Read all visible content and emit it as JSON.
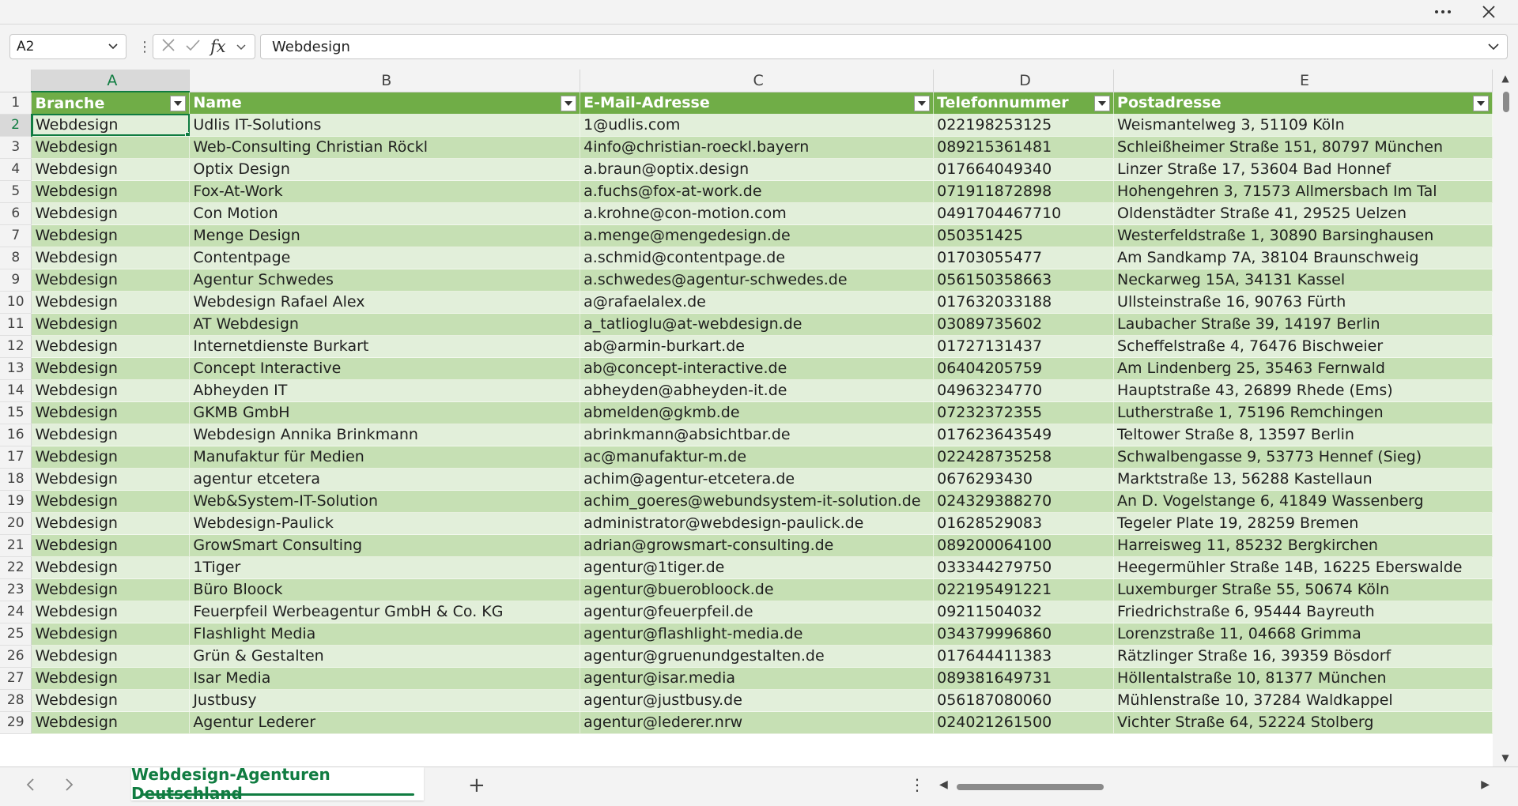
{
  "titlebar": {
    "more_icon": "more-horizontal-icon",
    "close_icon": "close-icon"
  },
  "formula_bar": {
    "name_box": "A2",
    "formula_value": "Webdesign",
    "cancel_icon": "cancel-x-icon",
    "enter_icon": "checkmark-icon",
    "fx_label": "fx"
  },
  "columns": [
    "A",
    "B",
    "C",
    "D",
    "E"
  ],
  "table": {
    "headers": [
      "Branche",
      "Name",
      "E-Mail-Adresse",
      "Telefonnummer",
      "Postadresse"
    ],
    "rows": [
      [
        "Webdesign",
        "Udlis IT-Solutions",
        "1@udlis.com",
        "022198253125",
        "Weismantelweg 3, 51109 Köln"
      ],
      [
        "Webdesign",
        "Web-Consulting Christian Röckl",
        "4info@christian-roeckl.bayern",
        "089215361481",
        "Schleißheimer Straße 151, 80797 München"
      ],
      [
        "Webdesign",
        "Optix Design",
        "a.braun@optix.design",
        "017664049340",
        "Linzer Straße 17, 53604 Bad Honnef"
      ],
      [
        "Webdesign",
        "Fox-At-Work",
        "a.fuchs@fox-at-work.de",
        "071911872898",
        "Hohengehren 3, 71573 Allmersbach Im Tal"
      ],
      [
        "Webdesign",
        "Con Motion",
        "a.krohne@con-motion.com",
        "0491704467710",
        "Oldenstädter Straße 41, 29525 Uelzen"
      ],
      [
        "Webdesign",
        "Menge Design",
        "a.menge@mengedesign.de",
        "050351425",
        "Westerfeldstraße 1, 30890 Barsinghausen"
      ],
      [
        "Webdesign",
        "Contentpage",
        "a.schmid@contentpage.de",
        "01703055477",
        "Am Sandkamp 7A, 38104 Braunschweig"
      ],
      [
        "Webdesign",
        "Agentur Schwedes",
        "a.schwedes@agentur-schwedes.de",
        "056150358663",
        "Neckarweg 15A, 34131 Kassel"
      ],
      [
        "Webdesign",
        "Webdesign Rafael Alex",
        "a@rafaelalex.de",
        "017632033188",
        "Ullsteinstraße 16, 90763 Fürth"
      ],
      [
        "Webdesign",
        "AT Webdesign",
        "a_tatlioglu@at-webdesign.de",
        "03089735602",
        "Laubacher Straße 39, 14197 Berlin"
      ],
      [
        "Webdesign",
        "Internetdienste Burkart",
        "ab@armin-burkart.de",
        "01727131437",
        "Scheffelstraße 4, 76476 Bischweier"
      ],
      [
        "Webdesign",
        "Concept Interactive",
        "ab@concept-interactive.de",
        "06404205759",
        "Am Lindenberg 25, 35463 Fernwald"
      ],
      [
        "Webdesign",
        "Abheyden IT",
        "abheyden@abheyden-it.de",
        "04963234770",
        "Hauptstraße 43, 26899 Rhede (Ems)"
      ],
      [
        "Webdesign",
        "GKMB GmbH",
        "abmelden@gkmb.de",
        "07232372355",
        "Lutherstraße 1, 75196 Remchingen"
      ],
      [
        "Webdesign",
        "Webdesign Annika Brinkmann",
        "abrinkmann@absichtbar.de",
        "017623643549",
        "Teltower Straße 8, 13597 Berlin"
      ],
      [
        "Webdesign",
        "Manufaktur für Medien",
        "ac@manufaktur-m.de",
        "022428735258",
        "Schwalbengasse 9, 53773 Hennef (Sieg)"
      ],
      [
        "Webdesign",
        "agentur etcetera",
        "achim@agentur-etcetera.de",
        "0676293430",
        "Marktstraße 13, 56288 Kastellaun"
      ],
      [
        "Webdesign",
        "Web&System-IT-Solution",
        "achim_goeres@webundsystem-it-solution.de",
        "024329388270",
        "An D. Vogelstange 6, 41849 Wassenberg"
      ],
      [
        "Webdesign",
        "Webdesign-Paulick",
        "administrator@webdesign-paulick.de",
        "01628529083",
        "Tegeler Plate 19, 28259 Bremen"
      ],
      [
        "Webdesign",
        "GrowSmart Consulting",
        "adrian@growsmart-consulting.de",
        "089200064100",
        "Harreisweg 11, 85232 Bergkirchen"
      ],
      [
        "Webdesign",
        "1Tiger",
        "agentur@1tiger.de",
        "033344279750",
        "Heegermühler Straße 14B, 16225 Eberswalde"
      ],
      [
        "Webdesign",
        "Büro Bloock",
        "agentur@buerobloock.de",
        "022195491221",
        "Luxemburger Straße 55, 50674 Köln"
      ],
      [
        "Webdesign",
        "Feuerpfeil Werbeagentur GmbH & Co. KG",
        "agentur@feuerpfeil.de",
        "09211504032",
        "Friedrichstraße 6, 95444 Bayreuth"
      ],
      [
        "Webdesign",
        "Flashlight Media",
        "agentur@flashlight-media.de",
        "034379996860",
        "Lorenzstraße 11, 04668 Grimma"
      ],
      [
        "Webdesign",
        "Grün & Gestalten",
        "agentur@gruenundgestalten.de",
        "017644411383",
        "Rätzlinger Straße 16, 39359 Bösdorf"
      ],
      [
        "Webdesign",
        "Isar Media",
        "agentur@isar.media",
        "089381649731",
        "Höllentalstraße 10, 81377 München"
      ],
      [
        "Webdesign",
        "Justbusy",
        "agentur@justbusy.de",
        "056187080060",
        "Mühlenstraße 10, 37284 Waldkappel"
      ],
      [
        "Webdesign",
        "Agentur Lederer",
        "agentur@lederer.nrw",
        "024021261500",
        "Vichter Straße 64, 52224 Stolberg"
      ]
    ]
  },
  "sheet_tabs": {
    "active_tab": "Webdesign-Agenturen Deutschland",
    "add_label": "+",
    "more_label": "⋮"
  },
  "colors": {
    "header_green": "#70ad47",
    "band_dark": "#c6e0b4",
    "band_light": "#e2efda",
    "accent": "#107c41"
  }
}
